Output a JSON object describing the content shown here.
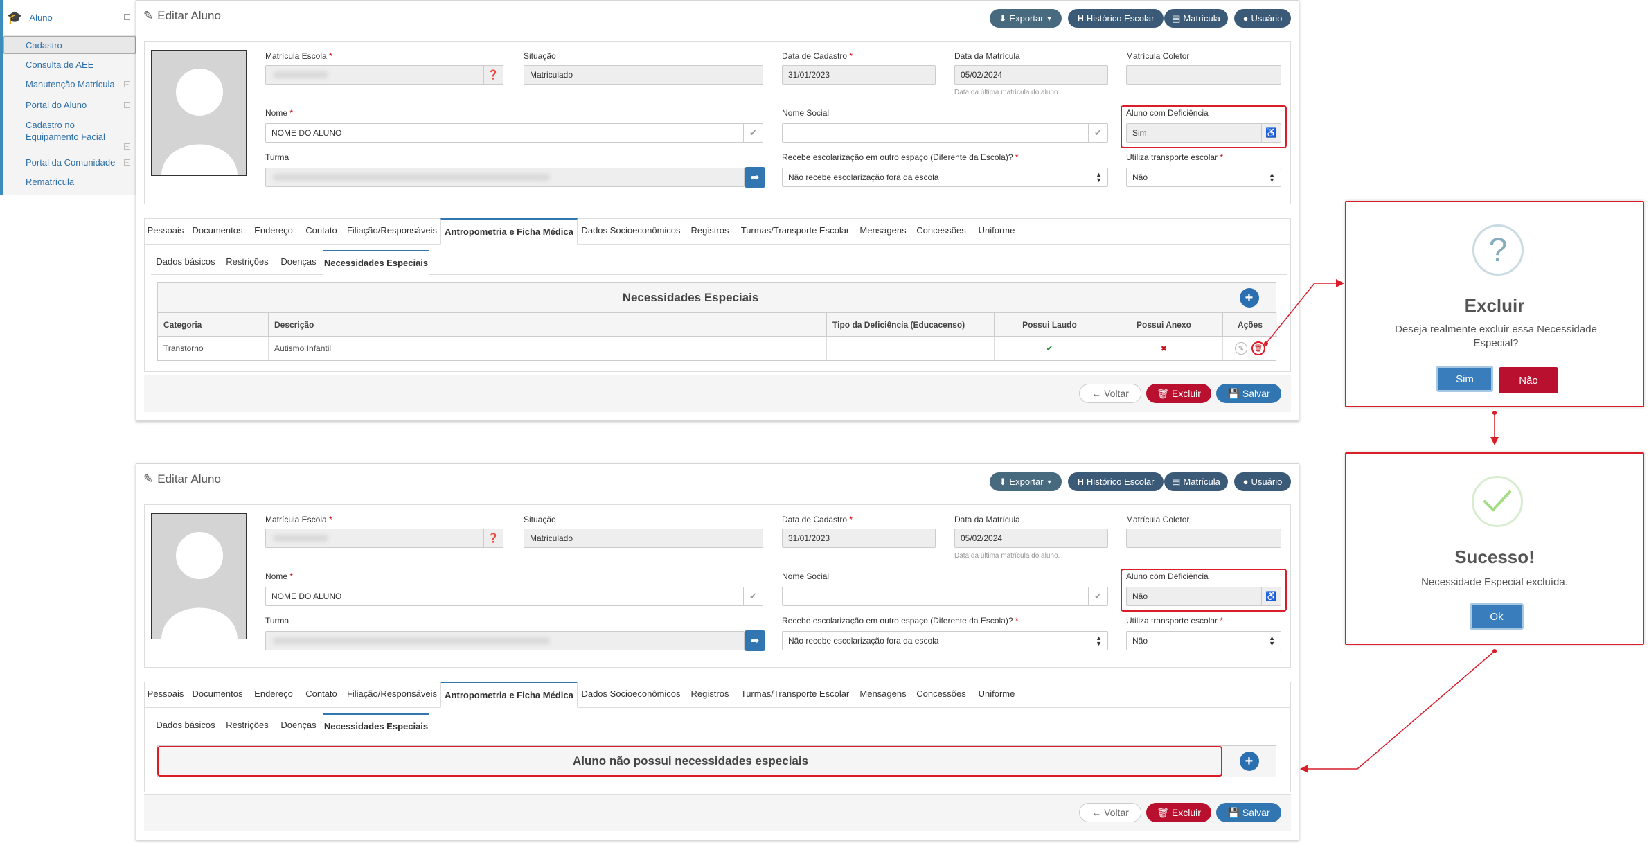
{
  "sidebar": {
    "title": "Aluno",
    "items": [
      {
        "label": "Cadastro"
      },
      {
        "label": "Consulta de AEE"
      },
      {
        "label": "Manutenção Matrícula"
      },
      {
        "label": "Portal do Aluno"
      },
      {
        "label": "Cadastro no Equipamento Facial"
      },
      {
        "label": "Portal da Comunidade"
      },
      {
        "label": "Rematrícula"
      }
    ]
  },
  "form": {
    "title": "Editar Aluno",
    "toolbar": {
      "export_label": "Exportar",
      "historico_label": "Histórico Escolar",
      "matricula_label": "Matrícula",
      "usuario_label": "Usuário"
    },
    "fields": {
      "matricula_escola_label": "Matrícula Escola",
      "situacao_label": "Situação",
      "situacao_value": "Matriculado",
      "data_cadastro_label": "Data de Cadastro",
      "data_cadastro_value": "31/01/2023",
      "data_matricula_label": "Data da Matrícula",
      "data_matricula_value": "05/02/2024",
      "data_matricula_hint": "Data da última matrícula do aluno.",
      "matricula_coletor_label": "Matrícula Coletor",
      "nome_label": "Nome",
      "nome_value": "NOME DO ALUNO",
      "nome_social_label": "Nome Social",
      "deficiencia_label": "Aluno com Deficiência",
      "turma_label": "Turma",
      "escolarizacao_label": "Recebe escolarização em outro espaço (Diferente da Escola)?",
      "escolarizacao_value": "Não recebe escolarização fora da escola",
      "transporte_label": "Utiliza transporte escolar",
      "transporte_value": "Não"
    },
    "tabs": [
      "Pessoais",
      "Documentos",
      "Endereço",
      "Contato",
      "Filiação/Responsáveis",
      "Antropometria e Ficha Médica",
      "Dados Socioeconômicos",
      "Registros",
      "Turmas/Transporte Escolar",
      "Mensagens",
      "Concessões",
      "Uniforme"
    ],
    "subtabs": [
      "Dados básicos",
      "Restrições",
      "Doenças",
      "Necessidades Especiais"
    ],
    "footer": {
      "back_label": "Voltar",
      "delete_label": "Excluir",
      "save_label": "Salvar"
    }
  },
  "before": {
    "deficiencia_value": "Sim",
    "table": {
      "caption": "Necessidades Especiais",
      "columns": [
        "Categoria",
        "Descrição",
        "Tipo da Deficiência (Educacenso)",
        "Possui Laudo",
        "Possui Anexo",
        "Ações"
      ],
      "rows": [
        {
          "categoria": "Transtorno",
          "descricao": "Autismo Infantil",
          "tipo": "",
          "laudo": "✔",
          "anexo": "✖"
        }
      ]
    }
  },
  "after": {
    "deficiencia_value": "Não",
    "empty_message": "Aluno não possui necessidades especiais"
  },
  "confirm_dialog": {
    "icon": "?",
    "title": "Excluir",
    "text": "Deseja realmente excluir essa Necessidade Especial?",
    "yes_label": "Sim",
    "no_label": "Não"
  },
  "success_dialog": {
    "title": "Sucesso!",
    "text": "Necessidade Especial excluída.",
    "ok_label": "Ok"
  },
  "colors": {
    "primary": "#3276b1",
    "danger": "#b8102e",
    "highlight": "#d91e2a",
    "toolbar": "#3a5a78"
  }
}
